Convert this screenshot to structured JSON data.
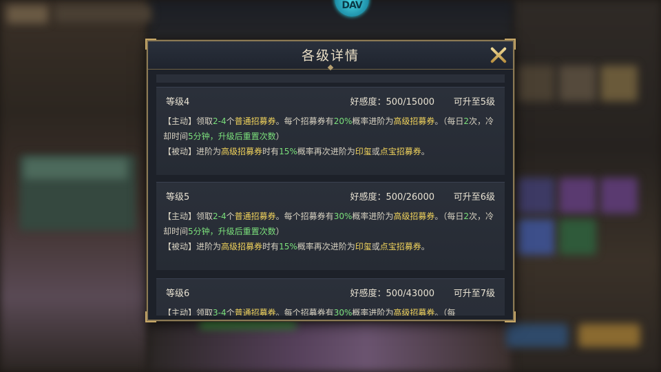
{
  "colors": {
    "highlight_green": "#7be07b",
    "highlight_yellow": "#f1d35c",
    "text": "#d8d2c2",
    "frame_gold": "#8c7a55"
  },
  "logo": {
    "icon": "game-logo-icon"
  },
  "dialog": {
    "title": "各级详情",
    "close_icon": "close-x-icon",
    "levels": [
      {
        "level": "等级4",
        "affinity": "好感度：500/15000",
        "upgrade": "可升至5级",
        "active": {
          "tag": "【主动】",
          "t1": "领取",
          "count": "2-4",
          "t2": "个",
          "ticket": "普通招募券",
          "t3": "。每个招募券有",
          "rate": "20%",
          "t4": "概率进阶为",
          "adv": "高级招募券",
          "t5": "。（每日",
          "times": "2",
          "t6": "次，冷却时间",
          "cd": "5分钟",
          "t7": "，升级后重置次数",
          "t8": "）"
        },
        "passive": {
          "tag": "【被动】",
          "t1": "进阶为",
          "adv": "高级招募券",
          "t2": "时有",
          "rate": "15%",
          "t3": "概率再次进阶为",
          "seal": "印玺",
          "t4": "或",
          "treasure": "点宝招募券",
          "t5": "。"
        }
      },
      {
        "level": "等级5",
        "affinity": "好感度：500/26000",
        "upgrade": "可升至6级",
        "active": {
          "tag": "【主动】",
          "t1": "领取",
          "count": "2-4",
          "t2": "个",
          "ticket": "普通招募券",
          "t3": "。每个招募券有",
          "rate": "30%",
          "t4": "概率进阶为",
          "adv": "高级招募券",
          "t5": "。（每日",
          "times": "2",
          "t6": "次，冷却时间",
          "cd": "5分钟",
          "t7": "，升级后重置次数",
          "t8": "）"
        },
        "passive": {
          "tag": "【被动】",
          "t1": "进阶为",
          "adv": "高级招募券",
          "t2": "时有",
          "rate": "15%",
          "t3": "概率再次进阶为",
          "seal": "印玺",
          "t4": "或",
          "treasure": "点宝招募券",
          "t5": "。"
        }
      },
      {
        "level": "等级6",
        "affinity": "好感度：500/43000",
        "upgrade": "可升至7级",
        "active": {
          "tag": "【主动】",
          "t1": "领取",
          "count": "3-4",
          "t2": "个",
          "ticket": "普通招募券",
          "t3": "。每个招募券有",
          "rate": "30%",
          "t4": "概率进阶为",
          "adv": "高级招募券",
          "t5": "。（每"
        }
      }
    ]
  }
}
